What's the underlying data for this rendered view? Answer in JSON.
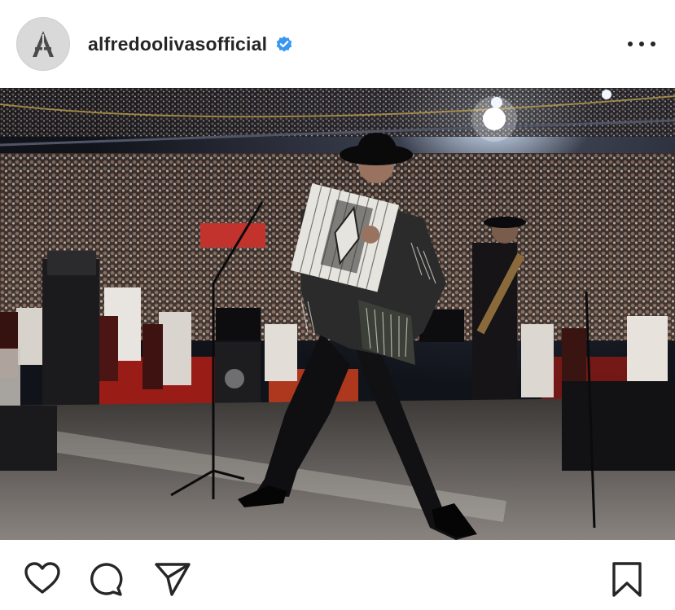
{
  "post": {
    "username": "alfredoolivasofficial",
    "verified": true,
    "avatar_icon": "logo-a-icon",
    "more_icon": "more-options-icon"
  },
  "photo": {
    "kind": "concert-photo"
  },
  "actions": {
    "icons": [
      "heart-icon",
      "comment-icon",
      "share-icon",
      "bookmark-icon"
    ]
  },
  "colors": {
    "verified_badge": "#3897f0",
    "icon_stroke": "#262626"
  }
}
